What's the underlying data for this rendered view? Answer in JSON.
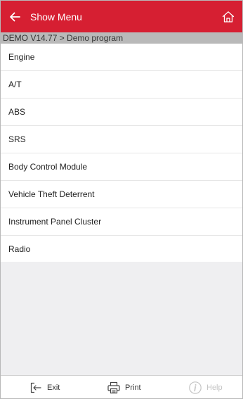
{
  "header": {
    "title": "Show Menu",
    "back_icon": "arrow-left-icon",
    "home_icon": "home-icon",
    "background_color": "#d61f32"
  },
  "breadcrumb": {
    "text": "DEMO V14.77 > Demo program"
  },
  "menu": {
    "items": [
      {
        "label": "Engine"
      },
      {
        "label": "A/T"
      },
      {
        "label": "ABS"
      },
      {
        "label": "SRS"
      },
      {
        "label": "Body Control Module"
      },
      {
        "label": "Vehicle Theft Deterrent"
      },
      {
        "label": "Instrument Panel Cluster"
      },
      {
        "label": "Radio"
      }
    ]
  },
  "footer": {
    "exit_label": "Exit",
    "exit_icon": "exit-icon",
    "print_label": "Print",
    "print_icon": "printer-icon",
    "help_label": "Help",
    "help_icon": "info-icon",
    "help_enabled": false
  }
}
